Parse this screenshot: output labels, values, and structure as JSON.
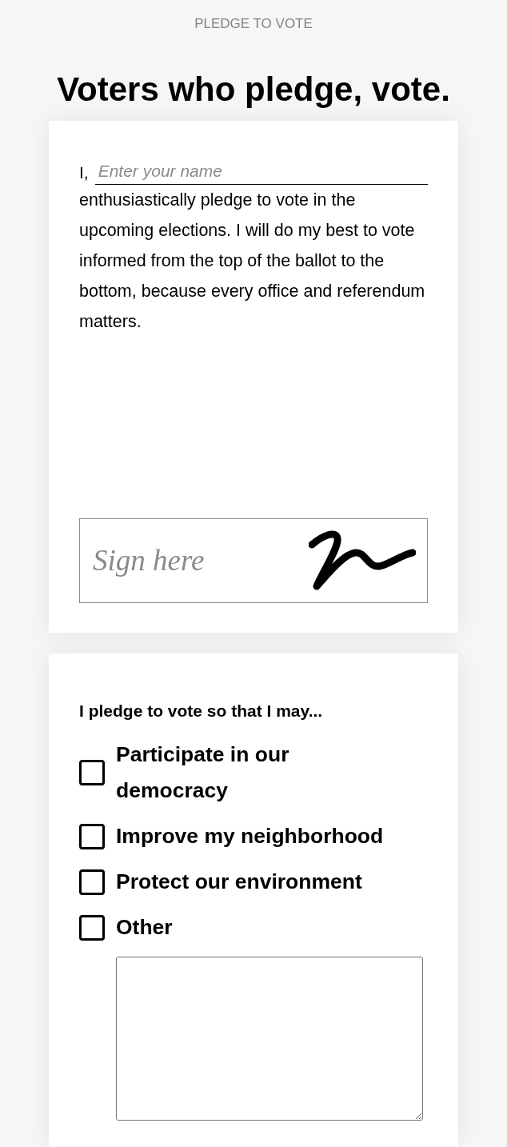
{
  "header": {
    "eyebrow": "PLEDGE TO VOTE",
    "title": "Voters who pledge, vote."
  },
  "pledge_card": {
    "prefix": "I,",
    "name_field": {
      "placeholder": "Enter your name"
    },
    "text": "enthusiastically pledge to vote in the upcoming elections. I will do my best to vote informed from the top of the ballot to the bottom, because every office and referendum matters.",
    "signature": {
      "placeholder": "Sign here",
      "signed": true
    }
  },
  "reasons_card": {
    "heading": "I pledge to vote so that I may...",
    "options": [
      {
        "kind": "checkbox",
        "label": "Participate in our democracy",
        "checked": false
      },
      {
        "kind": "checkbox",
        "label": "Improve my neighborhood",
        "checked": false
      },
      {
        "kind": "checkbox",
        "label": "Protect our environment",
        "checked": false
      },
      {
        "kind": "checkbox_with_text",
        "label": "Other",
        "checked": false
      }
    ]
  }
}
